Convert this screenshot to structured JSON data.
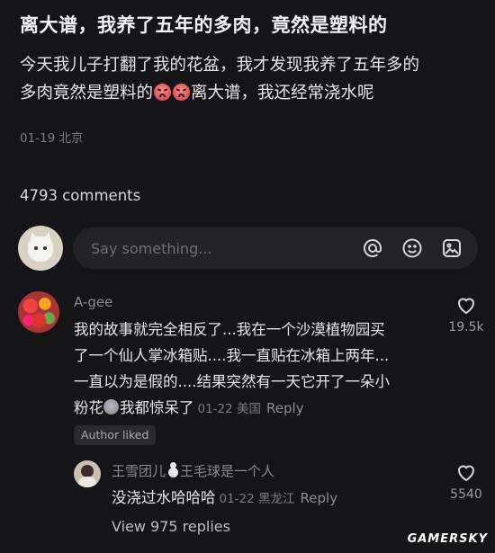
{
  "post": {
    "title": "离大谱，我养了五年的多肉，竟然是塑料的",
    "body_line1": "今天我儿子打翻了我的花盆，我才发现我养了五年多的",
    "body_line2a": "多肉竟然是塑料的",
    "body_line2b": "离大谱，我还经常浇水呢",
    "meta": "01-19 北京"
  },
  "comments_count": "4793 comments",
  "compose": {
    "placeholder": "Say something...",
    "icons": [
      "at-icon",
      "emoji-icon",
      "image-icon"
    ]
  },
  "comment": {
    "author": "A-gee",
    "lines": [
      "我的故事就完全相反了...我在一个沙漠植物园买",
      "了一个仙人掌冰箱贴....我一直贴在冰箱上两年...",
      "一直以为是假的....结果突然有一天它开了一朵小"
    ],
    "last_line_text_a": "粉花",
    "last_line_text_b": "我都惊呆了",
    "meta": "01-22 美国",
    "reply_label": "Reply",
    "likes": "19.5k",
    "badge": "Author liked"
  },
  "reply": {
    "author_a": "王雪团儿",
    "author_b": "王毛球是一个人",
    "text": "没浇过水哈哈哈",
    "meta": "01-22 黑龙江",
    "reply_label": "Reply",
    "likes": "5540"
  },
  "view_replies": "View 975 replies",
  "watermark": "GAMERSKY",
  "colors": {
    "background": "#151518",
    "input_bg": "#232327",
    "muted_text": "#7b7b80"
  }
}
